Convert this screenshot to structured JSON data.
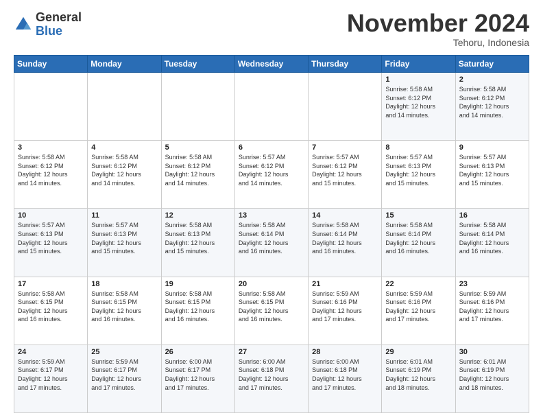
{
  "header": {
    "logo_general": "General",
    "logo_blue": "Blue",
    "month_title": "November 2024",
    "location": "Tehoru, Indonesia"
  },
  "days_of_week": [
    "Sunday",
    "Monday",
    "Tuesday",
    "Wednesday",
    "Thursday",
    "Friday",
    "Saturday"
  ],
  "weeks": [
    [
      {
        "day": "",
        "info": ""
      },
      {
        "day": "",
        "info": ""
      },
      {
        "day": "",
        "info": ""
      },
      {
        "day": "",
        "info": ""
      },
      {
        "day": "",
        "info": ""
      },
      {
        "day": "1",
        "info": "Sunrise: 5:58 AM\nSunset: 6:12 PM\nDaylight: 12 hours\nand 14 minutes."
      },
      {
        "day": "2",
        "info": "Sunrise: 5:58 AM\nSunset: 6:12 PM\nDaylight: 12 hours\nand 14 minutes."
      }
    ],
    [
      {
        "day": "3",
        "info": "Sunrise: 5:58 AM\nSunset: 6:12 PM\nDaylight: 12 hours\nand 14 minutes."
      },
      {
        "day": "4",
        "info": "Sunrise: 5:58 AM\nSunset: 6:12 PM\nDaylight: 12 hours\nand 14 minutes."
      },
      {
        "day": "5",
        "info": "Sunrise: 5:58 AM\nSunset: 6:12 PM\nDaylight: 12 hours\nand 14 minutes."
      },
      {
        "day": "6",
        "info": "Sunrise: 5:57 AM\nSunset: 6:12 PM\nDaylight: 12 hours\nand 14 minutes."
      },
      {
        "day": "7",
        "info": "Sunrise: 5:57 AM\nSunset: 6:12 PM\nDaylight: 12 hours\nand 15 minutes."
      },
      {
        "day": "8",
        "info": "Sunrise: 5:57 AM\nSunset: 6:13 PM\nDaylight: 12 hours\nand 15 minutes."
      },
      {
        "day": "9",
        "info": "Sunrise: 5:57 AM\nSunset: 6:13 PM\nDaylight: 12 hours\nand 15 minutes."
      }
    ],
    [
      {
        "day": "10",
        "info": "Sunrise: 5:57 AM\nSunset: 6:13 PM\nDaylight: 12 hours\nand 15 minutes."
      },
      {
        "day": "11",
        "info": "Sunrise: 5:57 AM\nSunset: 6:13 PM\nDaylight: 12 hours\nand 15 minutes."
      },
      {
        "day": "12",
        "info": "Sunrise: 5:58 AM\nSunset: 6:13 PM\nDaylight: 12 hours\nand 15 minutes."
      },
      {
        "day": "13",
        "info": "Sunrise: 5:58 AM\nSunset: 6:14 PM\nDaylight: 12 hours\nand 16 minutes."
      },
      {
        "day": "14",
        "info": "Sunrise: 5:58 AM\nSunset: 6:14 PM\nDaylight: 12 hours\nand 16 minutes."
      },
      {
        "day": "15",
        "info": "Sunrise: 5:58 AM\nSunset: 6:14 PM\nDaylight: 12 hours\nand 16 minutes."
      },
      {
        "day": "16",
        "info": "Sunrise: 5:58 AM\nSunset: 6:14 PM\nDaylight: 12 hours\nand 16 minutes."
      }
    ],
    [
      {
        "day": "17",
        "info": "Sunrise: 5:58 AM\nSunset: 6:15 PM\nDaylight: 12 hours\nand 16 minutes."
      },
      {
        "day": "18",
        "info": "Sunrise: 5:58 AM\nSunset: 6:15 PM\nDaylight: 12 hours\nand 16 minutes."
      },
      {
        "day": "19",
        "info": "Sunrise: 5:58 AM\nSunset: 6:15 PM\nDaylight: 12 hours\nand 16 minutes."
      },
      {
        "day": "20",
        "info": "Sunrise: 5:58 AM\nSunset: 6:15 PM\nDaylight: 12 hours\nand 16 minutes."
      },
      {
        "day": "21",
        "info": "Sunrise: 5:59 AM\nSunset: 6:16 PM\nDaylight: 12 hours\nand 17 minutes."
      },
      {
        "day": "22",
        "info": "Sunrise: 5:59 AM\nSunset: 6:16 PM\nDaylight: 12 hours\nand 17 minutes."
      },
      {
        "day": "23",
        "info": "Sunrise: 5:59 AM\nSunset: 6:16 PM\nDaylight: 12 hours\nand 17 minutes."
      }
    ],
    [
      {
        "day": "24",
        "info": "Sunrise: 5:59 AM\nSunset: 6:17 PM\nDaylight: 12 hours\nand 17 minutes."
      },
      {
        "day": "25",
        "info": "Sunrise: 5:59 AM\nSunset: 6:17 PM\nDaylight: 12 hours\nand 17 minutes."
      },
      {
        "day": "26",
        "info": "Sunrise: 6:00 AM\nSunset: 6:17 PM\nDaylight: 12 hours\nand 17 minutes."
      },
      {
        "day": "27",
        "info": "Sunrise: 6:00 AM\nSunset: 6:18 PM\nDaylight: 12 hours\nand 17 minutes."
      },
      {
        "day": "28",
        "info": "Sunrise: 6:00 AM\nSunset: 6:18 PM\nDaylight: 12 hours\nand 17 minutes."
      },
      {
        "day": "29",
        "info": "Sunrise: 6:01 AM\nSunset: 6:19 PM\nDaylight: 12 hours\nand 18 minutes."
      },
      {
        "day": "30",
        "info": "Sunrise: 6:01 AM\nSunset: 6:19 PM\nDaylight: 12 hours\nand 18 minutes."
      }
    ]
  ]
}
